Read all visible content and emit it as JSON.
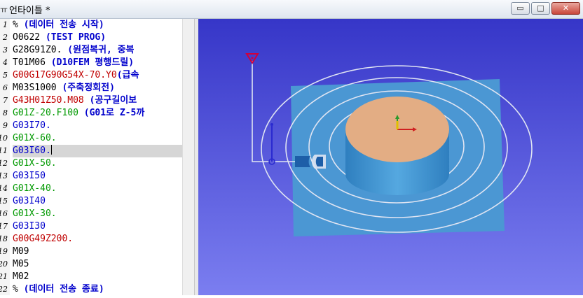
{
  "window": {
    "title": "언타이틀 *",
    "app_icon": "program-icon",
    "buttons": {
      "minimize": "▭",
      "maximize": "□",
      "close": "✕"
    }
  },
  "editor": {
    "current_line": 11,
    "lines": [
      {
        "n": "1",
        "segments": [
          {
            "text": "% ",
            "style": "black"
          },
          {
            "text": "(데이터 전송 시작)",
            "style": "comment"
          }
        ]
      },
      {
        "n": "2",
        "segments": [
          {
            "text": "O0622 ",
            "style": "black"
          },
          {
            "text": "(TEST PROG)",
            "style": "comment"
          }
        ]
      },
      {
        "n": "3",
        "segments": [
          {
            "text": "G28G91Z0. ",
            "style": "black"
          },
          {
            "text": "(원점복귀, 중복",
            "style": "comment"
          }
        ]
      },
      {
        "n": "4",
        "segments": [
          {
            "text": "T01M06 ",
            "style": "black"
          },
          {
            "text": "(D10FEM 평행드릴)",
            "style": "comment"
          }
        ]
      },
      {
        "n": "5",
        "segments": [
          {
            "text": "G00G17G90G54X-70.Y0",
            "style": "red"
          },
          {
            "text": "(급속",
            "style": "comment"
          }
        ]
      },
      {
        "n": "6",
        "segments": [
          {
            "text": "M03S1000 ",
            "style": "black"
          },
          {
            "text": "(주축정회전)",
            "style": "comment"
          }
        ]
      },
      {
        "n": "7",
        "segments": [
          {
            "text": "G43H01Z50.M08 ",
            "style": "red"
          },
          {
            "text": "(공구길이보",
            "style": "comment"
          }
        ]
      },
      {
        "n": "8",
        "segments": [
          {
            "text": "G01Z-20.F100 ",
            "style": "green"
          },
          {
            "text": "(G01로 Z-5까",
            "style": "comment"
          }
        ]
      },
      {
        "n": "9",
        "segments": [
          {
            "text": "G03I70.",
            "style": "blue"
          }
        ]
      },
      {
        "n": "10",
        "segments": [
          {
            "text": "G01X-60.",
            "style": "green"
          }
        ]
      },
      {
        "n": "11",
        "segments": [
          {
            "text": "G03I60.",
            "style": "blue"
          }
        ]
      },
      {
        "n": "12",
        "segments": [
          {
            "text": "G01X-50.",
            "style": "green"
          }
        ]
      },
      {
        "n": "13",
        "segments": [
          {
            "text": "G03I50",
            "style": "blue"
          }
        ]
      },
      {
        "n": "14",
        "segments": [
          {
            "text": "G01X-40.",
            "style": "green"
          }
        ]
      },
      {
        "n": "15",
        "segments": [
          {
            "text": "G03I40",
            "style": "blue"
          }
        ]
      },
      {
        "n": "16",
        "segments": [
          {
            "text": "G01X-30.",
            "style": "green"
          }
        ]
      },
      {
        "n": "17",
        "segments": [
          {
            "text": "G03I30",
            "style": "blue"
          }
        ]
      },
      {
        "n": "18",
        "segments": [
          {
            "text": "G00G49Z200.",
            "style": "red"
          }
        ]
      },
      {
        "n": "19",
        "segments": [
          {
            "text": "M09",
            "style": "black"
          }
        ]
      },
      {
        "n": "20",
        "segments": [
          {
            "text": "M05",
            "style": "black"
          }
        ]
      },
      {
        "n": "21",
        "segments": [
          {
            "text": "M02",
            "style": "black"
          }
        ]
      },
      {
        "n": "22",
        "segments": [
          {
            "text": "% ",
            "style": "black"
          },
          {
            "text": "(데이터 전송 종료)",
            "style": "comment"
          }
        ]
      }
    ]
  },
  "viewport": {
    "background_top": "#3636c8",
    "background_bottom": "#7b7ef0",
    "stock_color": "#4b97d3",
    "part_side_color": "#3a8cc8",
    "part_top_color": "#e3ad84",
    "toolpath_color": "#dfe4f2",
    "start_marker_color": "#d0003c"
  }
}
